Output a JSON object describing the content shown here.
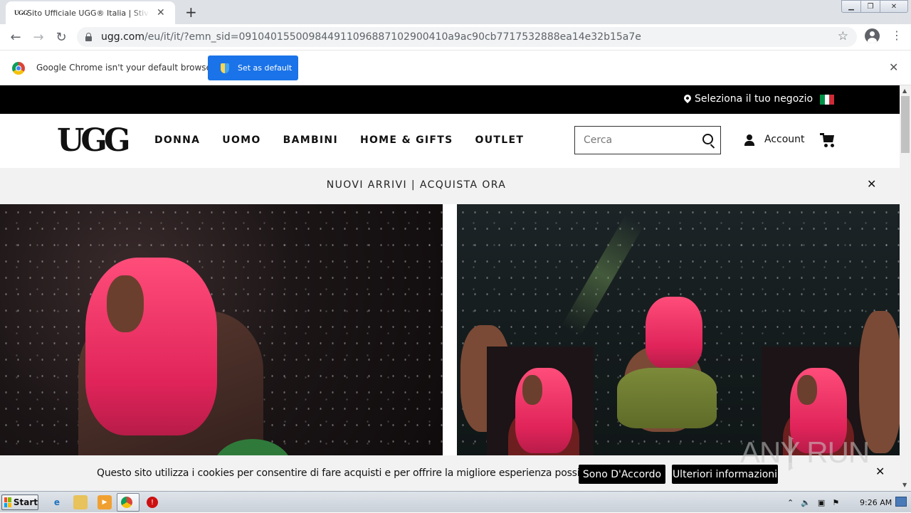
{
  "browser": {
    "tab_title": "Sito Ufficiale UGG® Italia | Stivali, Pantofole e Scarpe",
    "tab_favicon": "UGG",
    "url_host": "ugg.com",
    "url_path": "/eu/it/it/?emn_sid=0910401550098449110968871029004​10a9ac90cb7717532888ea14e32b15a7e",
    "infobar_text": "Google Chrome isn't your default browser",
    "infobar_button": "Set as default"
  },
  "site": {
    "store_label": "Seleziona il tuo negozio",
    "logo": "UGG",
    "nav": [
      "DONNA",
      "UOMO",
      "BAMBINI",
      "HOME & GIFTS",
      "OUTLET"
    ],
    "search_placeholder": "Cerca",
    "account_label": "Account",
    "promo_text": "NUOVI ARRIVI | ACQUISTA ORA",
    "cookie_text": "Questo sito utilizza i cookies per consentire di fare acquisti e per offrire la migliore esperienza possibile.",
    "cookie_agree": "Sono D'Accordo",
    "cookie_more": "Ulteriori informazioni",
    "watermark": "ANY  RUN"
  },
  "taskbar": {
    "start_label": "Start",
    "clock": "9:26 AM"
  },
  "colors": {
    "accent_blue": "#1a73e8",
    "hair_pink": "#e0245a",
    "flag": [
      "#009246",
      "#ffffff",
      "#ce2b37"
    ]
  },
  "icons": [
    "search-icon",
    "account-icon",
    "cart-icon",
    "location-pin-icon",
    "close-icon",
    "star-icon",
    "lock-icon"
  ]
}
